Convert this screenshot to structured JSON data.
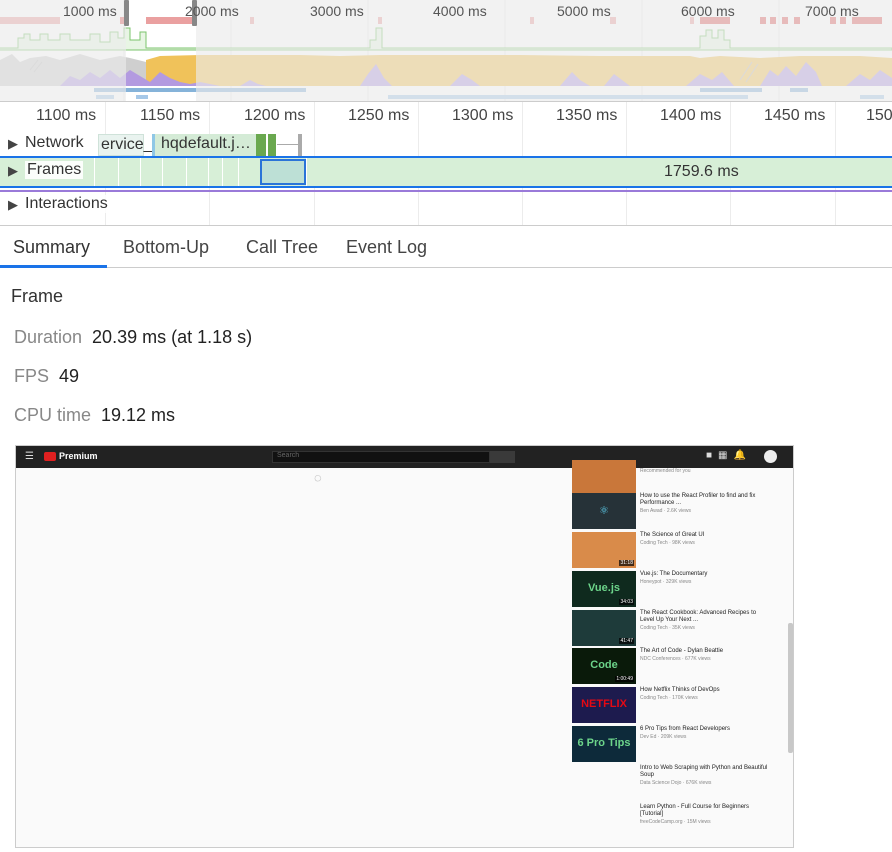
{
  "overview": {
    "ticks": [
      "1000 ms",
      "2000 ms",
      "3000 ms",
      "4000 ms",
      "5000 ms",
      "6000 ms",
      "7000 ms"
    ]
  },
  "timeline": {
    "ticks": [
      "1100 ms",
      "1150 ms",
      "1200 ms",
      "1250 ms",
      "1300 ms",
      "1350 ms",
      "1400 ms",
      "1450 ms",
      "150"
    ],
    "network_label": "Network",
    "network_request_fragment": "ervice_",
    "network_request_label": "hqdefault.j…",
    "frames_label": "Frames",
    "frames_duration": "1759.6 ms",
    "interactions_label": "Interactions",
    "toggle_glyph": "▶"
  },
  "tabs": [
    "Summary",
    "Bottom-Up",
    "Call Tree",
    "Event Log"
  ],
  "summary": {
    "title": "Frame",
    "duration_label": "Duration",
    "duration_value": "20.39 ms (at 1.18 s)",
    "fps_label": "FPS",
    "fps_value": "49",
    "cpu_label": "CPU time",
    "cpu_value": "19.12 ms"
  },
  "screenshot": {
    "logo_text": "Premium",
    "search_placeholder": "Search",
    "videos": [
      {
        "title": "",
        "meta": "Recommended for you",
        "duration": "",
        "thumb_color": "#c9773a",
        "thumb_text": ""
      },
      {
        "title": "How to use the React Profiler to find and fix Performance ...",
        "meta": "Ben Awad · 2.6K views",
        "duration": "",
        "thumb_color": "#263238",
        "thumb_text": "⚛"
      },
      {
        "title": "The Science of Great UI",
        "meta": "Coding Tech · 98K views",
        "duration": "31:18",
        "thumb_color": "#d98b4a",
        "thumb_text": ""
      },
      {
        "title": "Vue.js: The Documentary",
        "meta": "Honeypot · 329K views",
        "duration": "34:03",
        "thumb_color": "#0f2a1e",
        "thumb_text": "Vue.js"
      },
      {
        "title": "The React Cookbook: Advanced Recipes to Level Up Your Next ...",
        "meta": "Coding Tech · 35K views",
        "duration": "41:47",
        "thumb_color": "#1e3b3a",
        "thumb_text": ""
      },
      {
        "title": "The Art of Code - Dylan Beattie",
        "meta": "NDC Conferences · 677K views",
        "duration": "1:00:49",
        "thumb_color": "#0a1a0a",
        "thumb_text": "Code"
      },
      {
        "title": "How Netflix Thinks of DevOps",
        "meta": "Coding Tech · 170K views",
        "duration": "",
        "thumb_color": "#1d1b4e",
        "thumb_text": "NETFLIX"
      },
      {
        "title": "6 Pro Tips from React Developers",
        "meta": "Dev Ed · 209K views",
        "duration": "",
        "thumb_color": "#0d2a3a",
        "thumb_text": "6 Pro Tips"
      },
      {
        "title": "Intro to Web Scraping with Python and Beautiful Soup",
        "meta": "Data Science Dojo · 676K views",
        "duration": "",
        "thumb_color": "",
        "thumb_text": ""
      },
      {
        "title": "Learn Python - Full Course for Beginners [Tutorial]",
        "meta": "freeCodeCamp.org · 15M views",
        "duration": "",
        "thumb_color": "",
        "thumb_text": ""
      }
    ]
  }
}
